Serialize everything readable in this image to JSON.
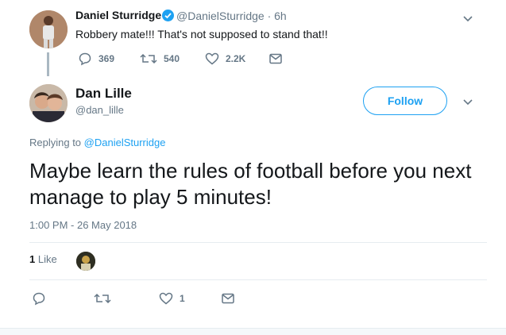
{
  "parent_tweet": {
    "name": "Daniel Sturridge",
    "handle_time": "@DanielSturridge · 6h",
    "text": "Robbery mate!!! That's not supposed to stand that!!",
    "replies": "369",
    "retweets": "540",
    "likes": "2.2K"
  },
  "main_tweet": {
    "name": "Dan Lille",
    "handle": "@dan_lille",
    "follow_label": "Follow",
    "replying_prefix": "Replying to ",
    "replying_handle": "@DanielSturridge",
    "text": "Maybe learn the rules of football before you next manage to play 5 minutes!",
    "timestamp": "1:00 PM - 26 May 2018",
    "like_count": "1",
    "like_label": "Like",
    "action_like_count": "1"
  },
  "colors": {
    "accent": "#1da1f2",
    "muted": "#657786",
    "text": "#14171a"
  }
}
